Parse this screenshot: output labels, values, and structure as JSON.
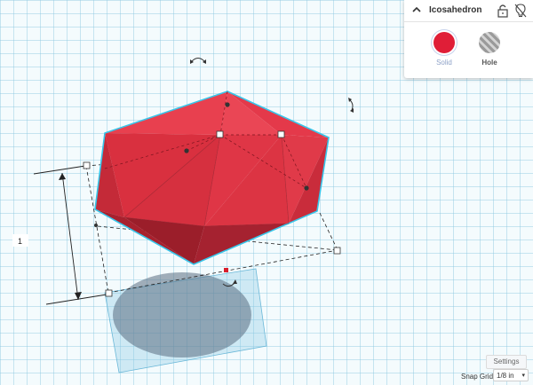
{
  "inspector": {
    "shape_name": "Icosahedron",
    "solid_label": "Solid",
    "hole_label": "Hole",
    "collapse_icon": "chevron-up-icon",
    "lock_icon": "lock-icon",
    "light_icon": "lightbulb-icon",
    "solid_color": "#e01e37"
  },
  "dimension": {
    "height_value": "1"
  },
  "footer": {
    "settings_label": "Settings",
    "snap_grid_label": "Snap Grid",
    "snap_grid_value": "1/8 in"
  },
  "colors": {
    "shape_primary": "#e13a4a",
    "shape_dark": "#a01f2c",
    "selection_outline": "#38c6ea",
    "grid_line": "#8cc8e1"
  }
}
